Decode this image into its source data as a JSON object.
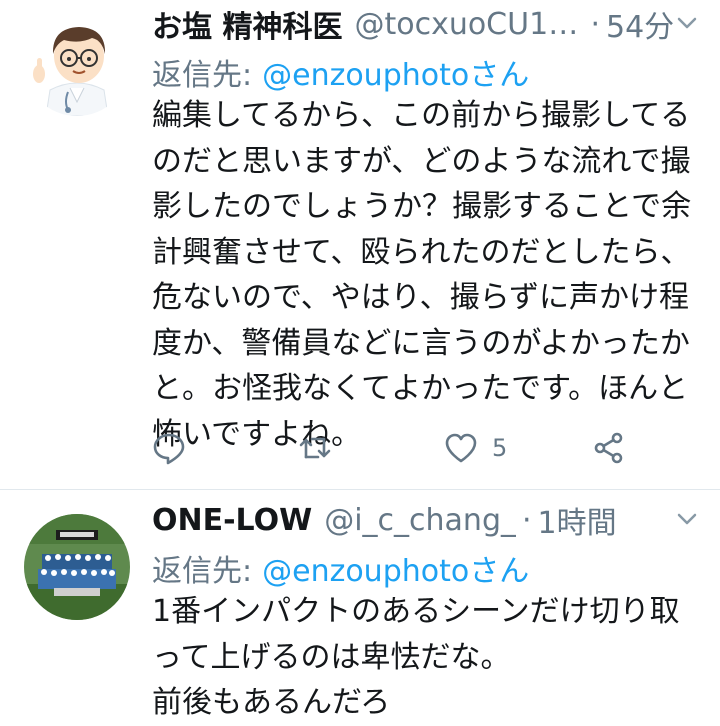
{
  "tweets": [
    {
      "name": "お塩 精神科医",
      "handle": "@tocxuoCU1A...",
      "time": "54分",
      "reply_prefix": "返信先:",
      "reply_mention": "@enzouphotoさん",
      "text": "編集してるから、この前から撮影してるのだと思いますが、どのような流れで撮影したのでしょうか？撮影することで余計興奮させて、殴られたのだとしたら、危ないので、やはり、撮らずに声かけ程度か、警備員などに言うのがよかったかと。お怪我なくてよかったです。ほんと怖いですよね。",
      "like_count": "5",
      "avatar_icon": "doctor-avatar"
    },
    {
      "name": "ONE-LOW",
      "handle": "@i_c_chang_",
      "time": "1時間",
      "reply_prefix": "返信先:",
      "reply_mention": "@enzouphotoさん",
      "text": "1番インパクトのあるシーンだけ切り取って上げるのは卑怯だな。\n前後もあるんだろ",
      "avatar_icon": "team-photo-avatar"
    }
  ],
  "separator": "·",
  "icons": {
    "reply": "reply-icon",
    "retweet": "retweet-icon",
    "like": "heart-icon",
    "share": "share-icon",
    "menu": "chevron-down-icon"
  },
  "colors": {
    "mention": "#1da1f2",
    "secondary_text": "#657786",
    "primary_text": "#14171a",
    "divider": "#e1e8ed"
  }
}
